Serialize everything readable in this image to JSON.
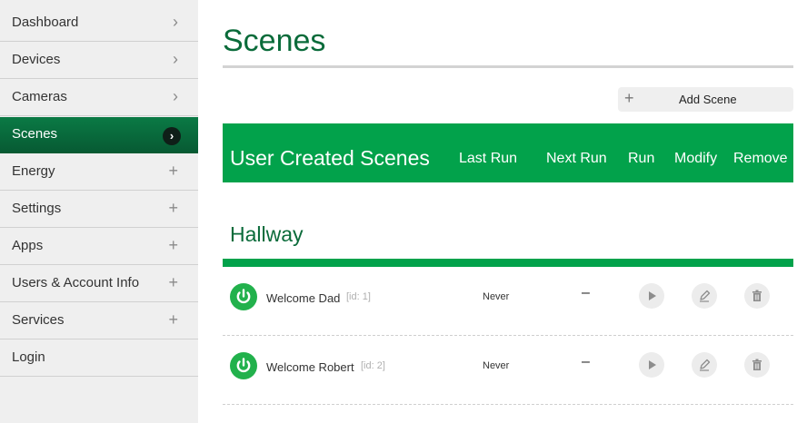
{
  "sidebar": {
    "items": [
      {
        "label": "Dashboard",
        "glyph": "›",
        "icon": "chevron-right-icon"
      },
      {
        "label": "Devices",
        "glyph": "›",
        "icon": "chevron-right-icon"
      },
      {
        "label": "Cameras",
        "glyph": "›",
        "icon": "chevron-right-icon"
      },
      {
        "label": "Scenes",
        "glyph": "›",
        "icon": "chevron-right-circle-icon",
        "active": true
      },
      {
        "label": "Energy",
        "glyph": "+",
        "icon": "plus-icon"
      },
      {
        "label": "Settings",
        "glyph": "+",
        "icon": "plus-icon"
      },
      {
        "label": "Apps",
        "glyph": "+",
        "icon": "plus-icon"
      },
      {
        "label": "Users & Account Info",
        "glyph": "+",
        "icon": "plus-icon"
      },
      {
        "label": "Services",
        "glyph": "+",
        "icon": "plus-icon"
      },
      {
        "label": "Login"
      }
    ]
  },
  "page": {
    "title": "Scenes",
    "add_button_label": "Add Scene",
    "add_button_icon": "+"
  },
  "table": {
    "title": "User Created Scenes",
    "columns": [
      "Last Run",
      "Next Run",
      "Run",
      "Modify",
      "Remove"
    ]
  },
  "group": {
    "title": "Hallway",
    "scenes": [
      {
        "name": "Welcome Dad",
        "id": "[id: 1]",
        "last_run": "Never",
        "next_run": "–"
      },
      {
        "name": "Welcome Robert",
        "id": "[id: 2]",
        "last_run": "Never",
        "next_run": "–"
      }
    ]
  },
  "colors": {
    "brand_green": "#02a24b",
    "active_nav": "#0a7a45",
    "title_green": "#0a6b3a",
    "power_green": "#22b14c"
  }
}
